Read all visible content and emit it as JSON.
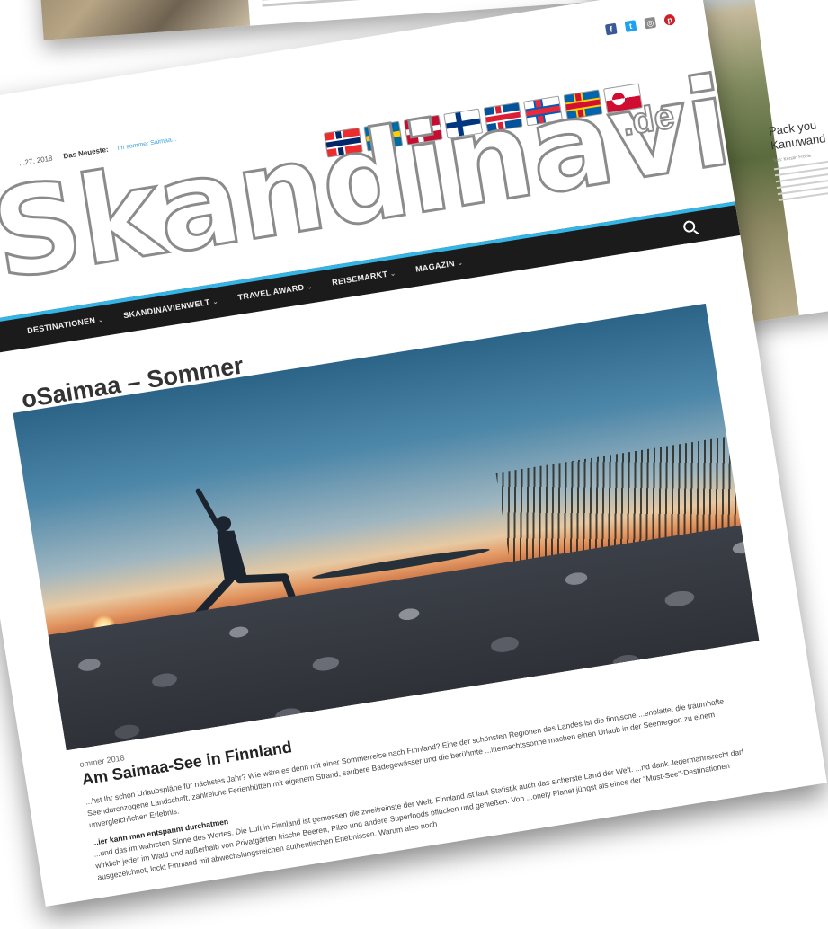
{
  "back_sheet_right": {
    "title": "Pack you... Kanuwand...",
    "title_line1": "Pack you",
    "title_line2": "Kanuwand",
    "byline": "Text: Kerstin Fröhle"
  },
  "header": {
    "topline_date": "...27, 2018",
    "topline_news_label": "Das Neueste:",
    "topline_ticker": "Im sommer Saimaa...",
    "logo_text": "Skandinavien",
    "logo_tld": ".de",
    "flags": [
      "norway",
      "sweden",
      "denmark",
      "finland",
      "iceland",
      "faroe-islands",
      "aland",
      "greenland"
    ],
    "social_icons": [
      "facebook-icon",
      "twitter-icon",
      "instagram-icon",
      "pinterest-icon"
    ]
  },
  "nav": {
    "items": [
      "DESTINATIONEN",
      "SKANDINAVIENWELT",
      "TRAVEL AWARD",
      "REISEMARKT",
      "MAGAZIN"
    ],
    "accent_color": "#35b5e5",
    "bar_color": "#1b1b1b"
  },
  "page": {
    "title": "oSaimaa – Sommer"
  },
  "article": {
    "date": "ommer 2018",
    "title": "Am Saimaa-See in Finnland",
    "paragraph_1": "...hst Ihr schon Urlaubspläne für nächstes Jahr? Wie wäre es denn mit einer Sommerreise nach Finnland? Eine der schönsten Regionen des Landes ist die finnische ...enplatte: die traumhafte Seendurchzogene Landschaft, zahlreiche Ferienhütten mit eigenem Strand, saubere Badegewässer und die berühmte ...itternachtssonne machen einen Urlaub in der Seenregion zu einem unvergleichlichen Erlebnis.",
    "subhead": "...ier kann man entspannt durchatmen",
    "paragraph_2": "...und das im wahrsten Sinne des Wortes. Die Luft in Finnland ist gemessen die zweitreinste der Welt. Finnland ist laut Statistik auch das sicherste Land der Welt. ...nd dank Jedermannsrecht darf wirklich jeder im Wald und außerhalb von Privatgärten frische Beeren, Pilze und andere Superfoods pflücken und genießen. Von ...onely Planet jüngst als eines der \"Must-See\"-Destinationen ausgezeichnet, lockt Finnland mit abwechslungsreichen authentischen Erlebnissen. Warum also noch"
  }
}
